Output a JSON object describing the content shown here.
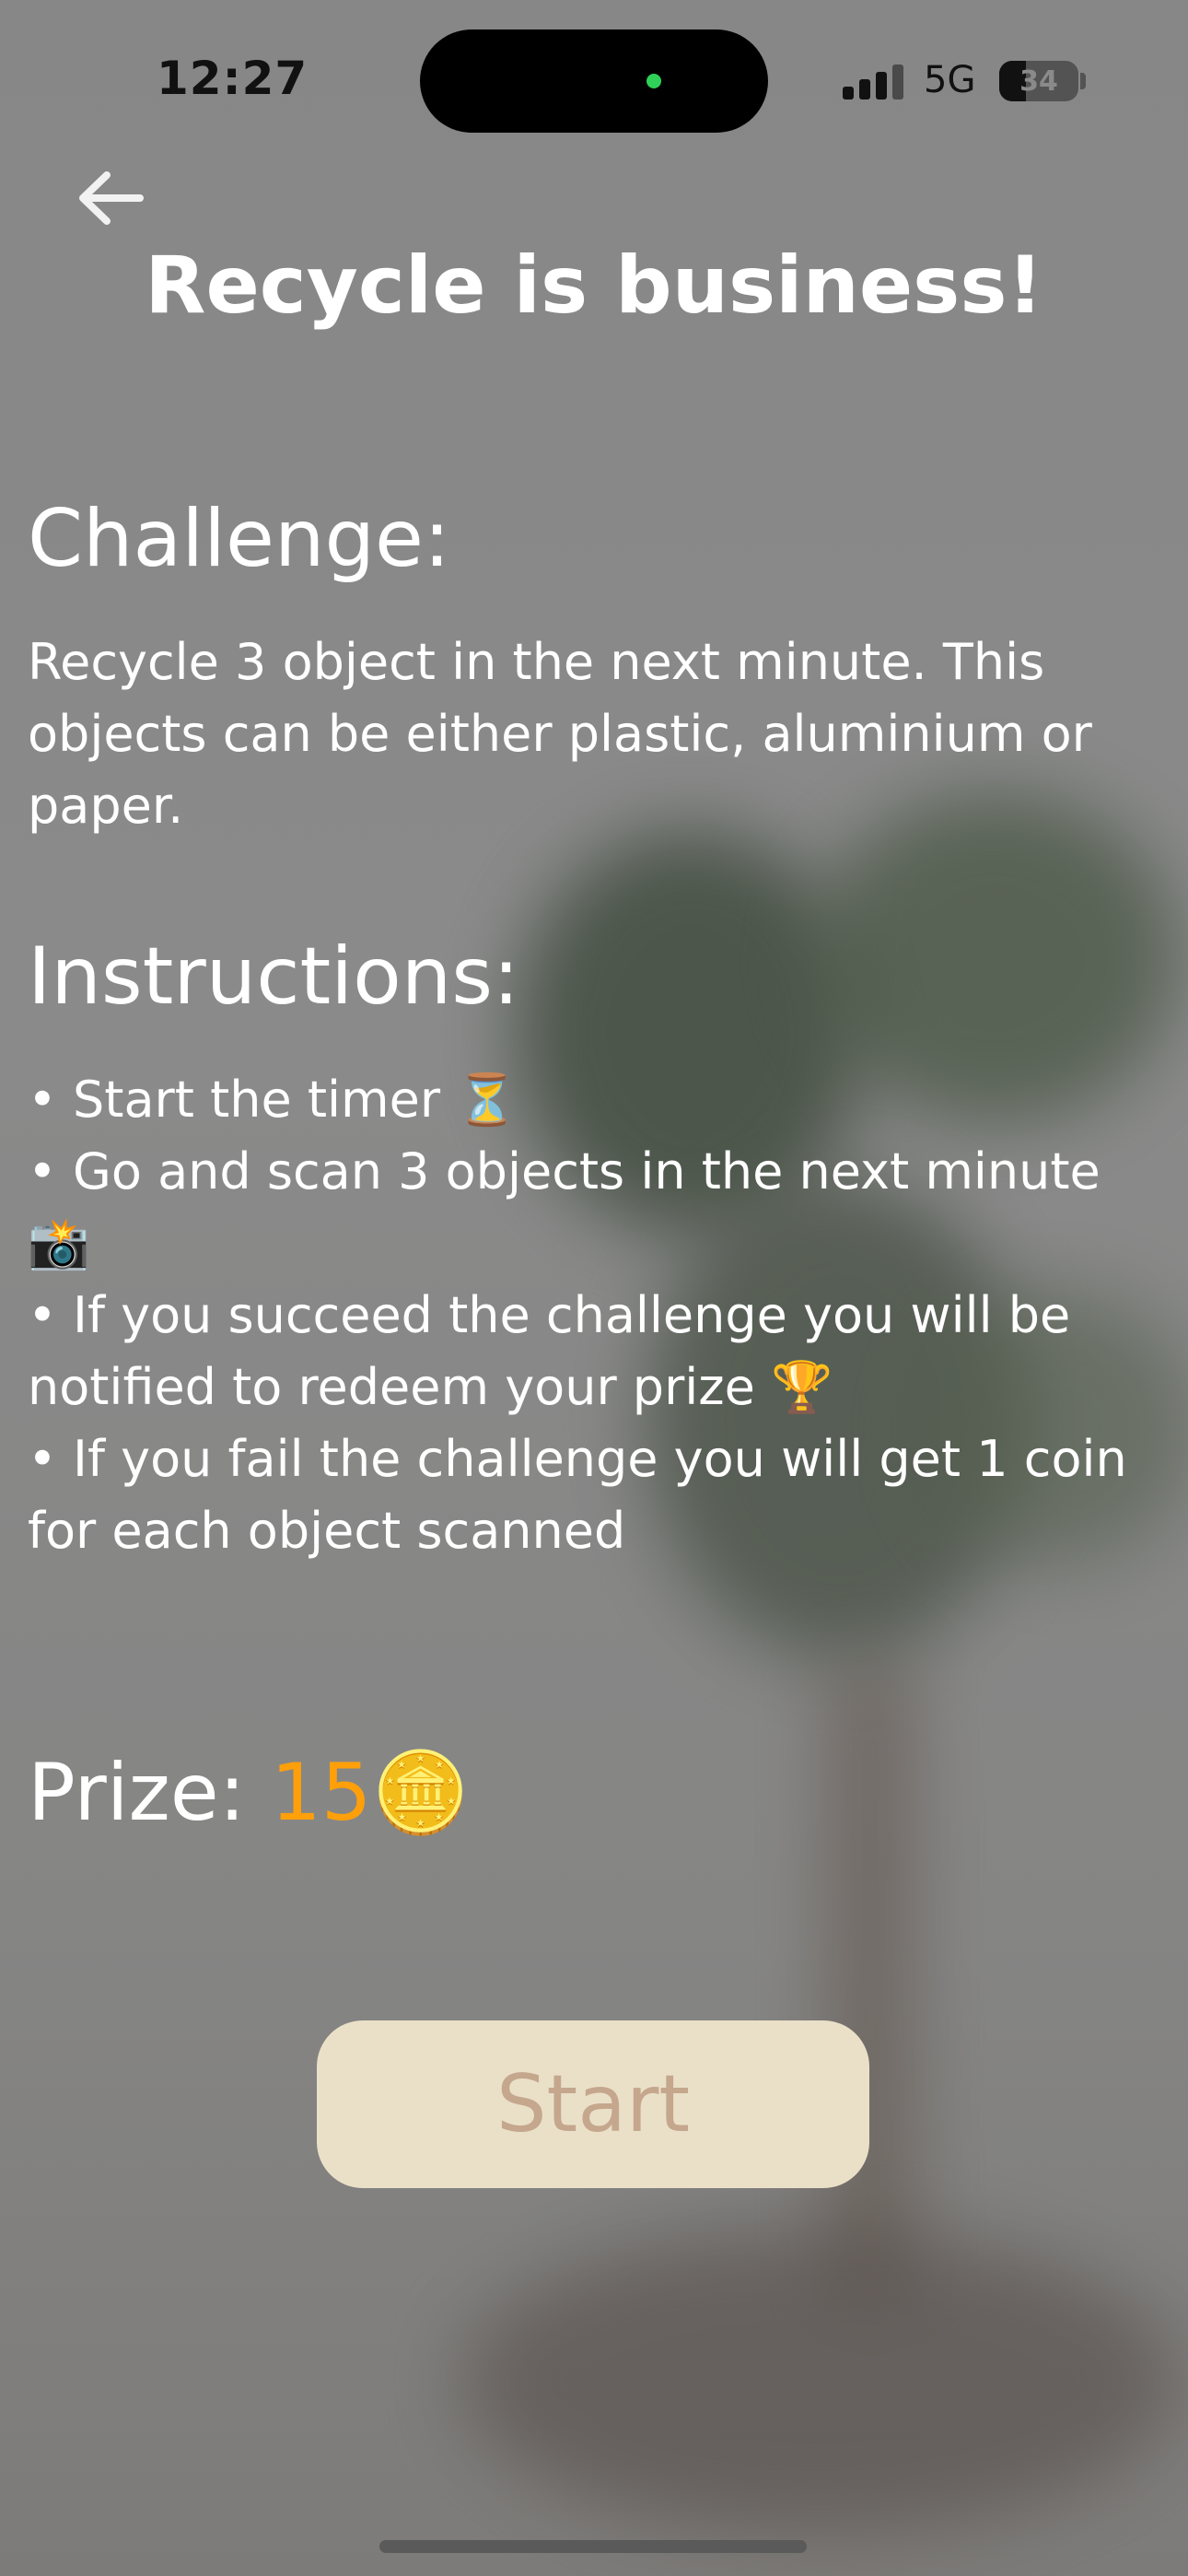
{
  "status_bar": {
    "time": "12:27",
    "network": "5G",
    "battery_percent": "34",
    "battery_level": 0.34,
    "signal_bars": 3
  },
  "header": {
    "back_icon": "arrow-left-icon",
    "title": "Recycle is business!"
  },
  "challenge": {
    "heading": "Challenge:",
    "text": "Recycle 3 object in the next minute. This objects can be either plastic, aluminium or paper."
  },
  "instructions": {
    "heading": "Instructions:",
    "items": [
      "• Start the timer ⏳",
      "• Go and scan 3 objects in the next minute 📸",
      "• If you succeed the challenge you will be notified to redeem your prize 🏆",
      "• If you fail the challenge you will get 1 coin for each object scanned"
    ]
  },
  "prize": {
    "label": "Prize:",
    "amount": "15",
    "icon": "🪙"
  },
  "start_button": {
    "label": "Start"
  },
  "colors": {
    "accent_prize": "#ff9f0a",
    "button_bg": "#eae0c8",
    "button_text": "#c5a78e",
    "dynamic_island_dot": "#2fd158"
  }
}
